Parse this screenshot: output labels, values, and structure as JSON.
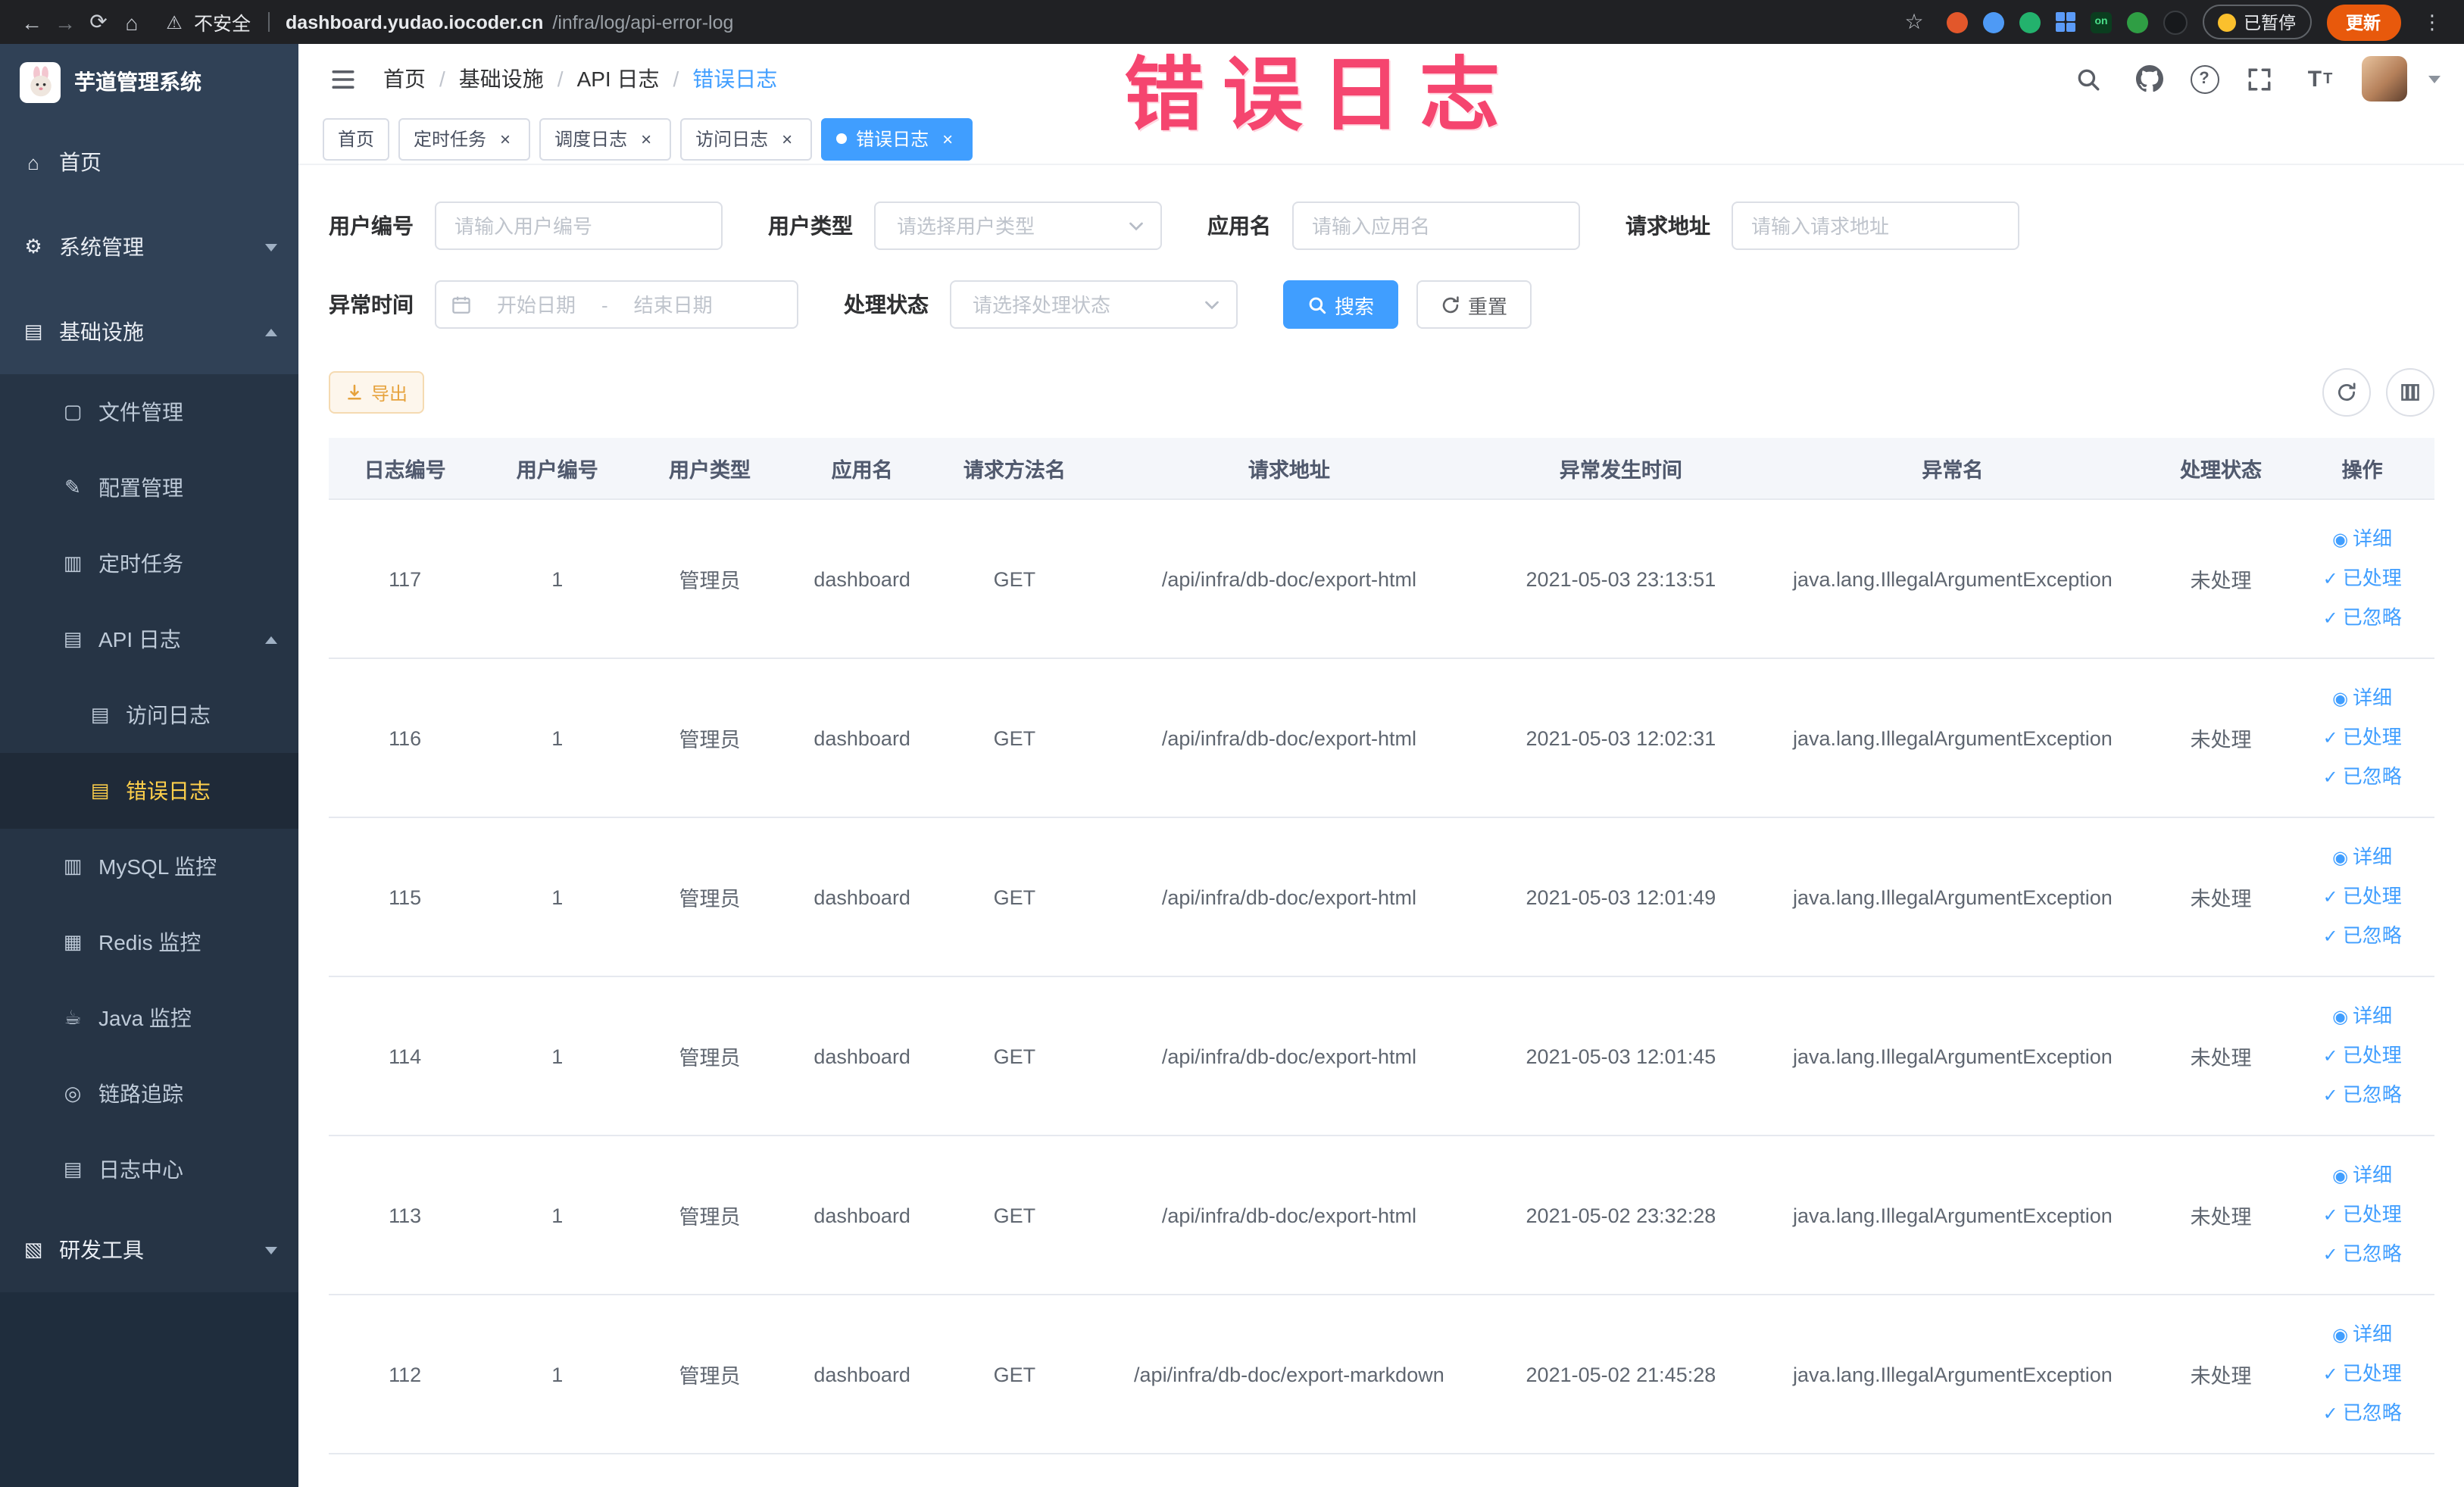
{
  "browser": {
    "security_label": "不安全",
    "url_host": "dashboard.yudao.iocoder.cn",
    "url_path": "/infra/log/api-error-log",
    "paused_badge": "已暂停",
    "update_label": "更新",
    "extension_on_label": "on"
  },
  "overlay_title": "错误日志",
  "colors": {
    "primary": "#409EFF",
    "sidebar_active": "#ffd04b",
    "warning": "#e6a23c",
    "annotation": "#f5456f"
  },
  "sidebar": {
    "logo_title": "芋道管理系统",
    "items": {
      "home": "首页",
      "system": "系统管理",
      "infra": "基础设施",
      "file": "文件管理",
      "config": "配置管理",
      "job": "定时任务",
      "api_log": "API 日志",
      "access_log": "访问日志",
      "error_log": "错误日志",
      "mysql": "MySQL 监控",
      "redis": "Redis 监控",
      "java": "Java 监控",
      "trace": "链路追踪",
      "log_center": "日志中心",
      "dev_tools": "研发工具"
    }
  },
  "breadcrumb": [
    "首页",
    "基础设施",
    "API 日志",
    "错误日志"
  ],
  "tabs": [
    {
      "label": "首页",
      "closable": false,
      "active": false
    },
    {
      "label": "定时任务",
      "closable": true,
      "active": false
    },
    {
      "label": "调度日志",
      "closable": true,
      "active": false
    },
    {
      "label": "访问日志",
      "closable": true,
      "active": false
    },
    {
      "label": "错误日志",
      "closable": true,
      "active": true
    }
  ],
  "filters": {
    "user_id": {
      "label": "用户编号",
      "placeholder": "请输入用户编号",
      "value": ""
    },
    "user_type": {
      "label": "用户类型",
      "placeholder": "请选择用户类型",
      "value": ""
    },
    "app_name": {
      "label": "应用名",
      "placeholder": "请输入应用名",
      "value": ""
    },
    "request_url": {
      "label": "请求地址",
      "placeholder": "请输入请求地址",
      "value": ""
    },
    "exception_time": {
      "label": "异常时间",
      "start_placeholder": "开始日期",
      "separator": "-",
      "end_placeholder": "结束日期"
    },
    "process_status": {
      "label": "处理状态",
      "placeholder": "请选择处理状态",
      "value": ""
    },
    "search_label": "搜索",
    "reset_label": "重置"
  },
  "toolbar": {
    "export_label": "导出"
  },
  "table": {
    "columns": [
      "日志编号",
      "用户编号",
      "用户类型",
      "应用名",
      "请求方法名",
      "请求地址",
      "异常发生时间",
      "异常名",
      "处理状态",
      "操作"
    ],
    "action_labels": {
      "detail": "详细",
      "processed": "已处理",
      "ignored": "已忽略"
    },
    "rows": [
      {
        "id": "117",
        "user_id": "1",
        "user_type": "管理员",
        "app": "dashboard",
        "method": "GET",
        "url": "/api/infra/db-doc/export-html",
        "time": "2021-05-03 23:13:51",
        "exception": "java.lang.IllegalArgumentException",
        "status": "未处理"
      },
      {
        "id": "116",
        "user_id": "1",
        "user_type": "管理员",
        "app": "dashboard",
        "method": "GET",
        "url": "/api/infra/db-doc/export-html",
        "time": "2021-05-03 12:02:31",
        "exception": "java.lang.IllegalArgumentException",
        "status": "未处理"
      },
      {
        "id": "115",
        "user_id": "1",
        "user_type": "管理员",
        "app": "dashboard",
        "method": "GET",
        "url": "/api/infra/db-doc/export-html",
        "time": "2021-05-03 12:01:49",
        "exception": "java.lang.IllegalArgumentException",
        "status": "未处理"
      },
      {
        "id": "114",
        "user_id": "1",
        "user_type": "管理员",
        "app": "dashboard",
        "method": "GET",
        "url": "/api/infra/db-doc/export-html",
        "time": "2021-05-03 12:01:45",
        "exception": "java.lang.IllegalArgumentException",
        "status": "未处理"
      },
      {
        "id": "113",
        "user_id": "1",
        "user_type": "管理员",
        "app": "dashboard",
        "method": "GET",
        "url": "/api/infra/db-doc/export-html",
        "time": "2021-05-02 23:32:28",
        "exception": "java.lang.IllegalArgumentException",
        "status": "未处理"
      },
      {
        "id": "112",
        "user_id": "1",
        "user_type": "管理员",
        "app": "dashboard",
        "method": "GET",
        "url": "/api/infra/db-doc/export-markdown",
        "time": "2021-05-02 21:45:28",
        "exception": "java.lang.IllegalArgumentException",
        "status": "未处理"
      }
    ]
  }
}
